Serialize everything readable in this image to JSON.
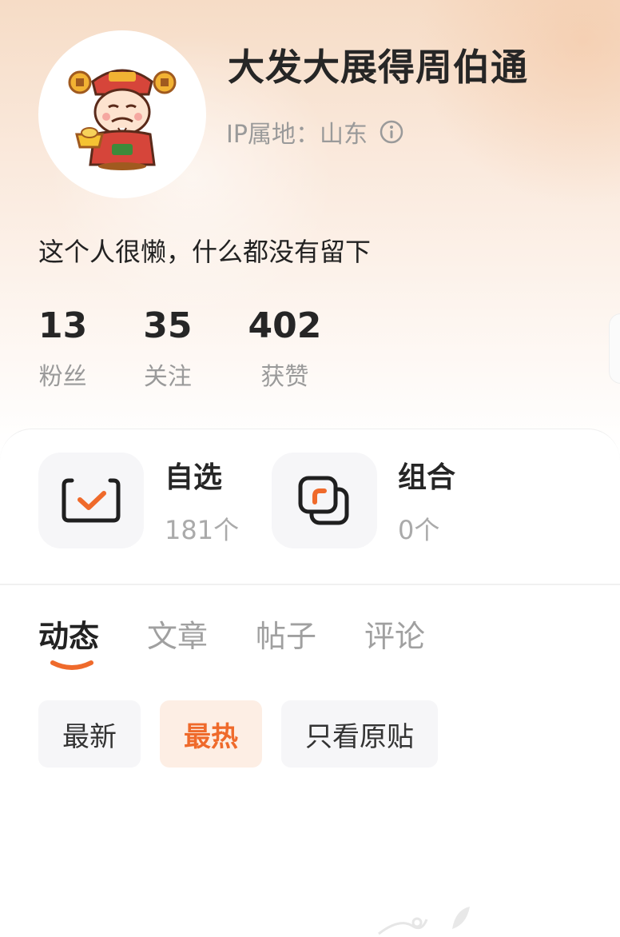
{
  "profile": {
    "username": "大发大展得周伯通",
    "ip_location": "IP属地：山东",
    "bio": "这个人很懒，什么都没有留下"
  },
  "stats": [
    {
      "value": "13",
      "label": "粉丝"
    },
    {
      "value": "35",
      "label": "关注"
    },
    {
      "value": "402",
      "label": "获赞"
    }
  ],
  "cards": {
    "watchlist": {
      "title": "自选",
      "count": "181个"
    },
    "portfolio": {
      "title": "组合",
      "count": "0个"
    }
  },
  "tabs": [
    "动态",
    "文章",
    "帖子",
    "评论"
  ],
  "filters": [
    "最新",
    "最热",
    "只看原贴"
  ],
  "colors": {
    "accent": "#ef6a2b",
    "accent_bg": "#fdeee4"
  },
  "icons": [
    "avatar-god-of-wealth",
    "info-icon",
    "check-box-icon",
    "overlap-squares-icon"
  ]
}
